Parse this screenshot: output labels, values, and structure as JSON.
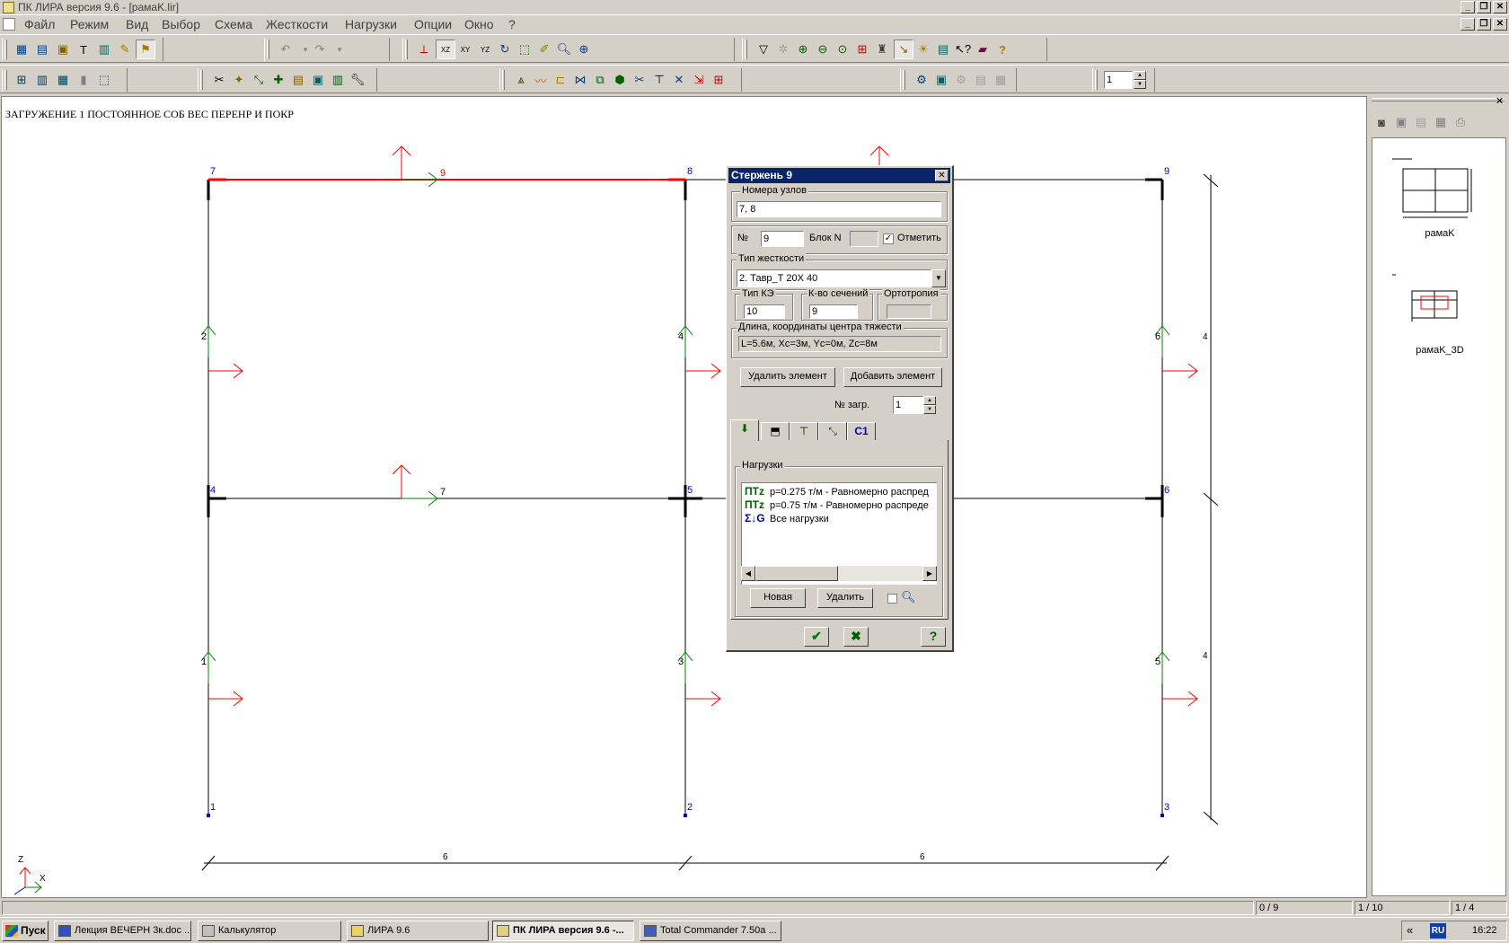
{
  "window": {
    "title": "ПК ЛИРА  версия 9.6 - [рамаK.lir]"
  },
  "menu": [
    "Файл",
    "Режим",
    "Вид",
    "Выбор",
    "Схема",
    "Жесткости",
    "Нагрузки",
    "Опции",
    "Окно",
    "?"
  ],
  "toolbar": {
    "spin_value": "1"
  },
  "canvas": {
    "title": "ЗАГРУЖЕНИЕ 1 ПОСТОЯННОЕ СОБ ВЕС ПЕРЕНР И ПОКР",
    "colors": {
      "selected": "#ff0000",
      "frame": "#000000",
      "node_label": "#0000c0",
      "axis_local_x": "#008000"
    },
    "node_labels": {
      "n1": "1",
      "n2": "2",
      "n3": "3",
      "n4": "4",
      "n5": "5",
      "n6": "6",
      "n7": "7",
      "n8": "8",
      "n9": "9"
    },
    "element_labels": {
      "e1": "1",
      "e2": "2",
      "e3": "3",
      "e4": "4",
      "e5": "5",
      "e6": "6",
      "e7": "7",
      "e9": "9"
    },
    "dimensions": {
      "span_left": "6",
      "span_right": "6",
      "height_upper": "4",
      "height_lower": "4"
    },
    "axes": {
      "z": "Z",
      "x": "X"
    }
  },
  "dialog": {
    "title": "Стержень  9",
    "node_numbers_label": "Номера узлов",
    "node_numbers_value": "7, 8",
    "number_label": "№",
    "number_value": "9",
    "block_label": "Блок N",
    "block_value": "",
    "mark_label": "Отметить",
    "mark_checked": true,
    "stiffness_type_label": "Тип жесткости",
    "stiffness_type_value": "2. Тавр_Т 20Х 40",
    "fe_type_label": "Тип КЭ",
    "fe_type_value": "10",
    "sections_label": "К-во сечений",
    "sections_value": "9",
    "orthotropy_label": "Ортотропия",
    "orthotropy_value": "",
    "length_label": "Длина, координаты центра тяжести",
    "length_value": "L=5.6м, Xc=3м, Yc=0м, Zc=8м",
    "delete_element": "Удалить элемент",
    "add_element": "Добавить элемент",
    "load_no_label": "№ загр.",
    "load_no_value": "1",
    "tabs": [
      "",
      "",
      "",
      "",
      "С1"
    ],
    "loads_label": "Нагрузки",
    "loads": [
      {
        "icon": "ПТz",
        "text": "p=0.275 т/м - Равномерно распред"
      },
      {
        "icon": "ПТz",
        "text": "p=0.75 т/м - Равномерно распреде"
      },
      {
        "icon": "Σ↓G",
        "text": "Все нагрузки"
      }
    ],
    "new_button": "Новая",
    "delete_button": "Удалить"
  },
  "right_panel": {
    "thumbs": [
      {
        "label": "рамаK"
      },
      {
        "label": "рамаK_3D"
      }
    ]
  },
  "status": {
    "p1": "0 / 9",
    "p2": "1 / 10",
    "p3": "1 / 4"
  },
  "taskbar": {
    "start": "Пуск",
    "tasks": [
      {
        "label": "Лекция ВЕЧЕРН 3к.doc ..."
      },
      {
        "label": "Калькулятор"
      },
      {
        "label": "ЛИРА 9.6"
      },
      {
        "label": "ПК ЛИРА  версия 9.6 -..."
      },
      {
        "label": "Total Commander 7.50a ..."
      }
    ],
    "lang": "RU",
    "chevron": "«",
    "clock": "16:22"
  }
}
